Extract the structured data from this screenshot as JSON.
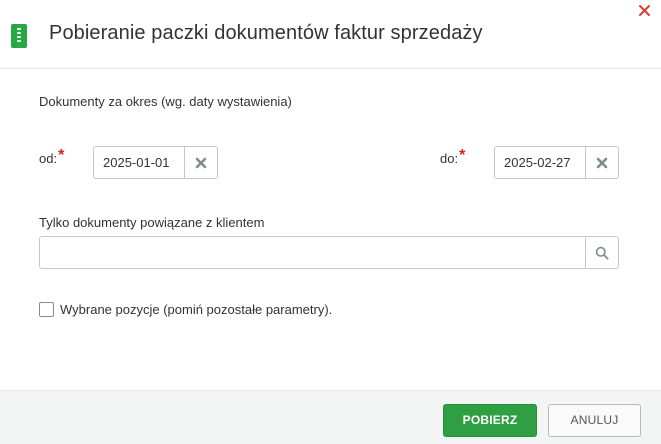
{
  "dialog": {
    "title": "Pobieranie paczki dokumentów faktur sprzedaży",
    "icon": "document-icon",
    "close_icon": "close-icon"
  },
  "period": {
    "label": "Dokumenty za okres (wg. daty wystawienia)",
    "from": {
      "label": "od:",
      "required_mark": "*",
      "value": "2025-01-01"
    },
    "to": {
      "label": "do:",
      "required_mark": "*",
      "value": "2025-02-27"
    }
  },
  "client": {
    "label": "Tylko dokumenty powiązane z klientem",
    "value": "",
    "search_icon": "search-icon"
  },
  "selected_only": {
    "label": "Wybrane pozycje (pomiń pozostałe parametry).",
    "checked": false
  },
  "footer": {
    "download_label": "POBIERZ",
    "cancel_label": "ANULUJ"
  },
  "colors": {
    "accent": "#2ea043",
    "required": "#e02020",
    "close": "#e03c3c"
  }
}
